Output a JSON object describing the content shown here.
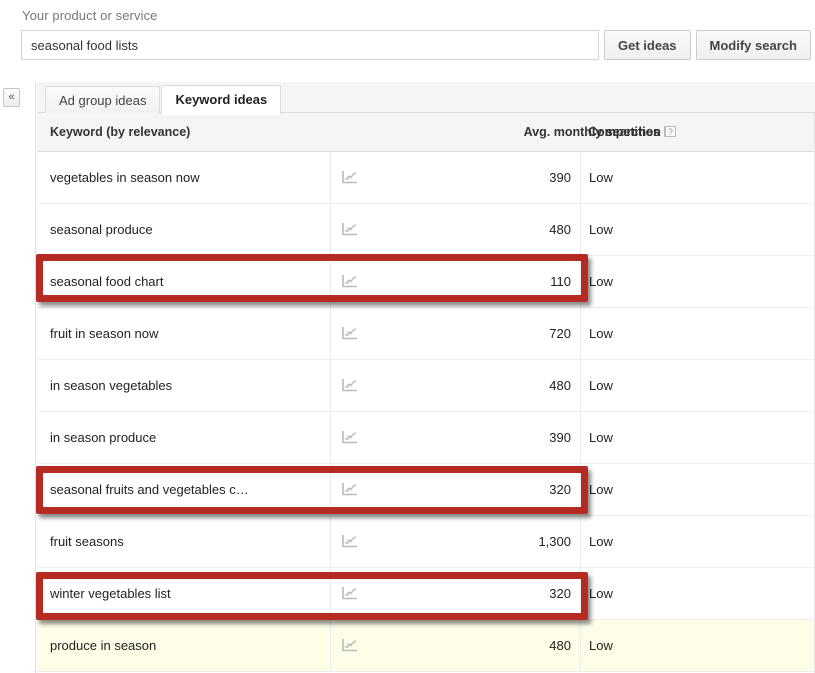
{
  "search": {
    "label": "Your product or service",
    "value": "seasonal food lists",
    "placeholder": "",
    "get_ideas_label": "Get ideas",
    "modify_search_label": "Modify search"
  },
  "rail": {
    "collapse_label": "«"
  },
  "tabs": [
    {
      "label": "Ad group ideas",
      "active": false
    },
    {
      "label": "Keyword ideas",
      "active": true
    }
  ],
  "table": {
    "columns": {
      "keyword": "Keyword (by relevance)",
      "searches": "Avg. monthly searches",
      "competition": "Competition",
      "help_glyph": "?"
    },
    "rows": [
      {
        "keyword": "vegetables in season now",
        "searches": "390",
        "competition": "Low",
        "highlighted": false,
        "annotated": false
      },
      {
        "keyword": "seasonal produce",
        "searches": "480",
        "competition": "Low",
        "highlighted": false,
        "annotated": false
      },
      {
        "keyword": "seasonal food chart",
        "searches": "110",
        "competition": "Low",
        "highlighted": false,
        "annotated": true
      },
      {
        "keyword": "fruit in season now",
        "searches": "720",
        "competition": "Low",
        "highlighted": false,
        "annotated": false
      },
      {
        "keyword": "in season vegetables",
        "searches": "480",
        "competition": "Low",
        "highlighted": false,
        "annotated": false
      },
      {
        "keyword": "in season produce",
        "searches": "390",
        "competition": "Low",
        "highlighted": false,
        "annotated": false
      },
      {
        "keyword": "seasonal fruits and vegetables c…",
        "searches": "320",
        "competition": "Low",
        "highlighted": false,
        "annotated": true
      },
      {
        "keyword": "fruit seasons",
        "searches": "1,300",
        "competition": "Low",
        "highlighted": false,
        "annotated": false
      },
      {
        "keyword": "winter vegetables list",
        "searches": "320",
        "competition": "Low",
        "highlighted": false,
        "annotated": true
      },
      {
        "keyword": "produce in season",
        "searches": "480",
        "competition": "Low",
        "highlighted": true,
        "annotated": false
      }
    ]
  },
  "annotation": {
    "color": "#b52b22"
  }
}
